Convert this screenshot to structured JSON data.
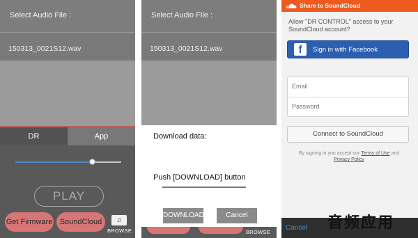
{
  "panel1": {
    "header": "Select Audio File :",
    "file": "150313_0021S12.wav",
    "tabs": [
      "DR",
      "App"
    ],
    "slider_level": 0.73,
    "play": "PLAY",
    "get_firmware": "Get Firmware",
    "soundcloud": "SoundCloud",
    "browse_icon": "music-note-icon",
    "browse": "BROWSE"
  },
  "panel2": {
    "header": "Select Audio File :",
    "file": "150313_0021S12.wav",
    "dialog_title": "Download data:",
    "dialog_message": "Push [DOWNLOAD] button",
    "download": "DOWNLOAD",
    "cancel": "Cancel",
    "browse": "BROWSE"
  },
  "panel3": {
    "top_title": "Share to SoundCloud",
    "allow": "Allow \"DR CONTROL\" access to your SoundCloud account?",
    "facebook": "Sign in with Facebook",
    "email_placeholder": "Email",
    "password_placeholder": "Password",
    "connect": "Connect to SoundCloud",
    "terms_prefix": "By signing in you accept our",
    "terms_link": "Terms of Use",
    "terms_and": "and",
    "privacy_link": "Privacy Policy",
    "cancel": "Cancel"
  },
  "watermark": "音频应用",
  "colors": {
    "accent_red": "#d77676",
    "soundcloud_orange": "#ee5a1f",
    "facebook_blue": "#2d5fb0",
    "slider_blue": "#4f86c9"
  }
}
